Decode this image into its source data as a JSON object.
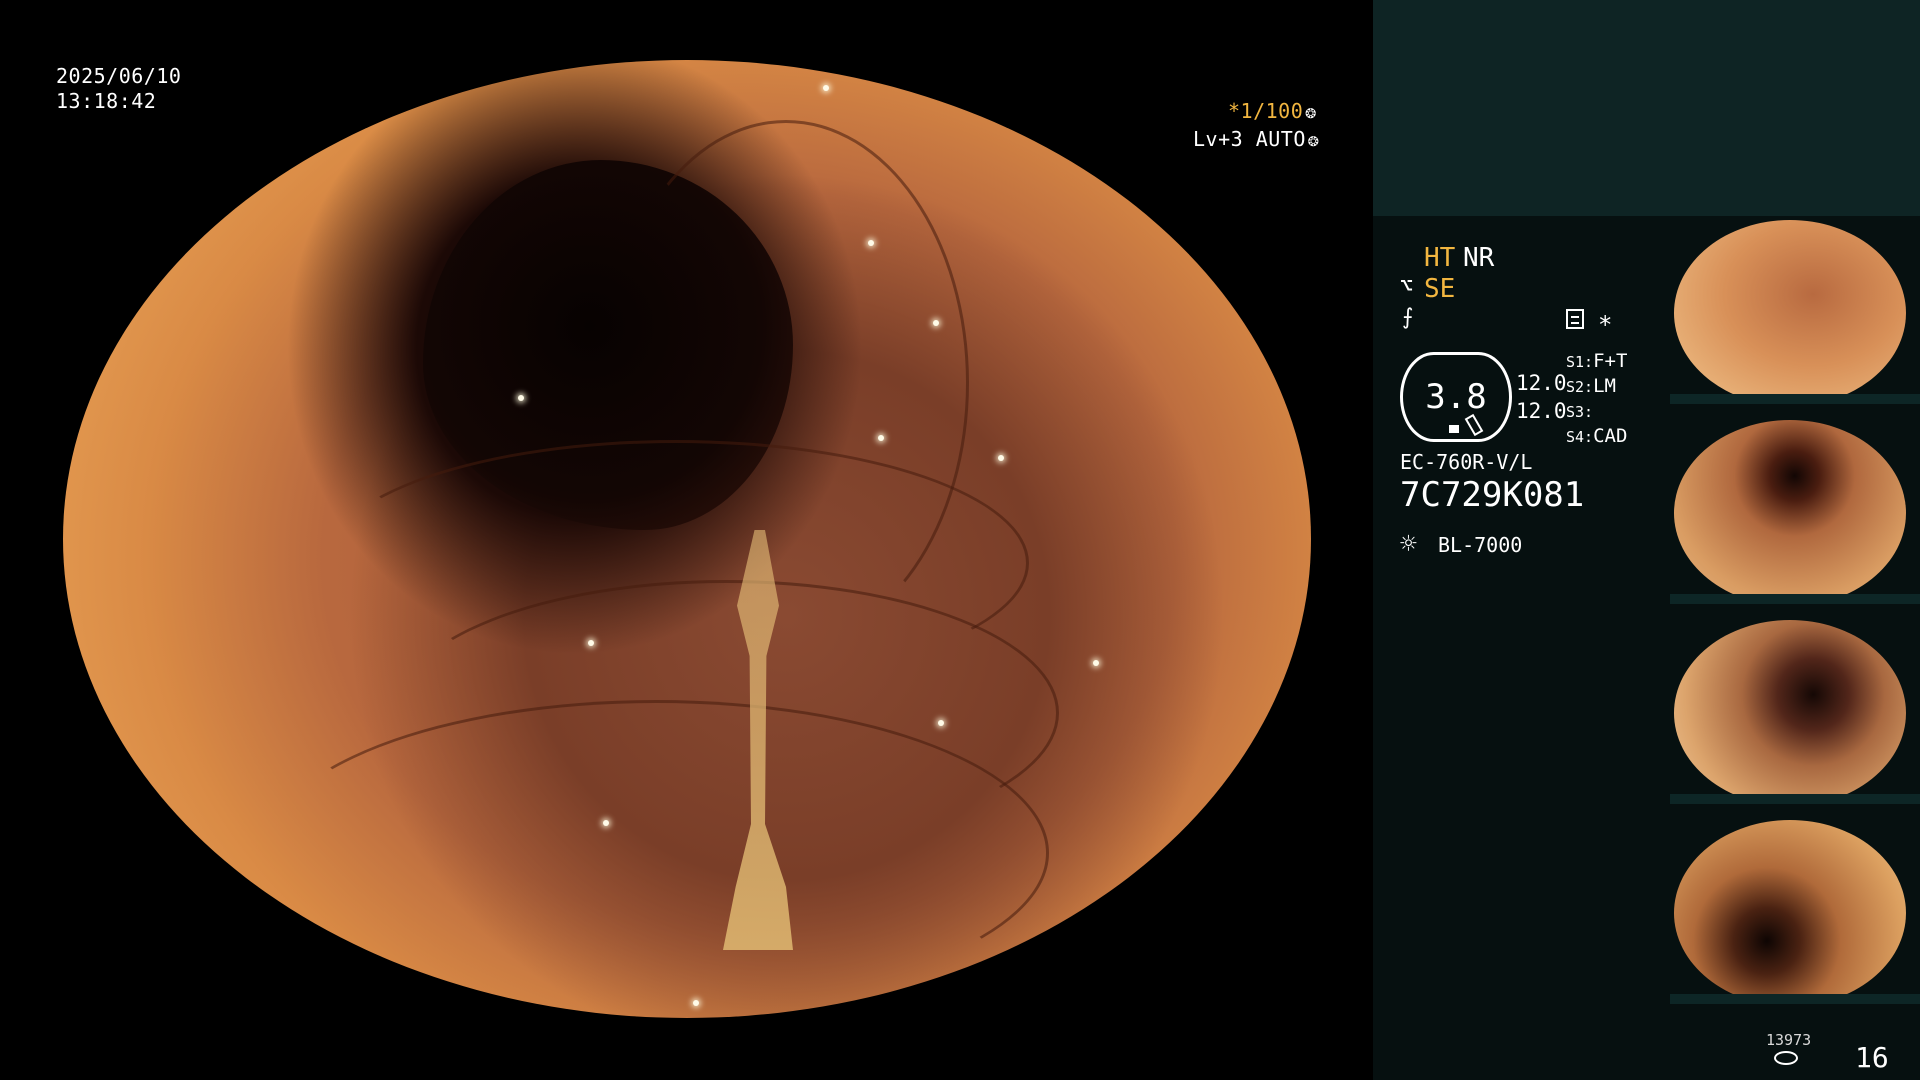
{
  "scope_overlay": {
    "date": "2025/06/10",
    "time": "13:18:42",
    "shutter": "*1/100",
    "shutter_icon": "❂",
    "level": "Lv+3 AUTO",
    "level_icon": "❂"
  },
  "status": {
    "ht": "HT",
    "nr": "NR",
    "se_icon": "⌥",
    "se": "SE",
    "freeze_icon": "⨍",
    "star": "∗"
  },
  "gauge": {
    "value": "3.8",
    "num1": "12.0",
    "num2": "12.0"
  },
  "switches": [
    {
      "label": "S1:",
      "value": "F+T"
    },
    {
      "label": "S2:",
      "value": "LM"
    },
    {
      "label": "S3:",
      "value": ""
    },
    {
      "label": "S4:",
      "value": "CAD"
    }
  ],
  "scope_info": {
    "model": "EC-760R-V/L",
    "serial": "7C729K081",
    "light_icon": "☼",
    "light_source": "BL-7000"
  },
  "counters": {
    "small": "13973",
    "big": "16"
  },
  "colors": {
    "accent": "#f2b640",
    "panel_top": "#0e2424",
    "panel": "#061010"
  }
}
